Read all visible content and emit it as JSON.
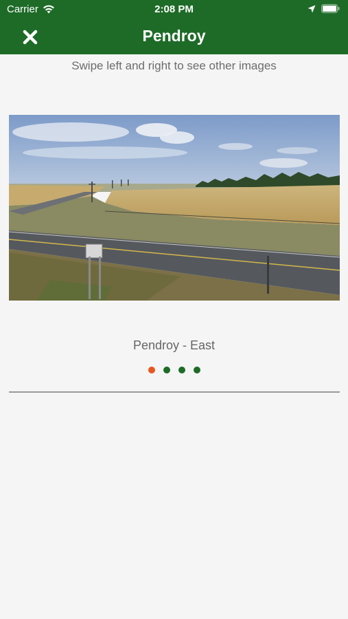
{
  "status_bar": {
    "carrier": "Carrier",
    "time": "2:08 PM",
    "icons": [
      "wifi-icon",
      "location-arrow-icon",
      "battery-icon"
    ]
  },
  "nav": {
    "title": "Pendroy",
    "close_icon": "close-icon"
  },
  "gallery": {
    "hint": "Swipe left and right to see other images",
    "caption": "Pendroy - East",
    "image_count": 4,
    "active_index": 0
  },
  "colors": {
    "header": "#1e6b28",
    "dot_active": "#e8571e",
    "dot_inactive": "#1e6b28",
    "background": "#f5f5f5"
  }
}
